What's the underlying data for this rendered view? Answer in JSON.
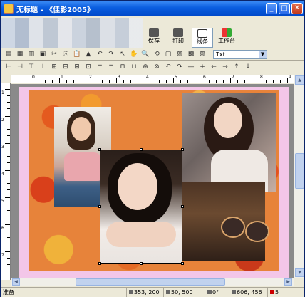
{
  "titlebar": {
    "title": "无标题 - 《佳影2005》",
    "buttons": [
      "_",
      "□",
      "✕"
    ]
  },
  "bigtoolbar": {
    "save_label": "保存",
    "print_label": "打印",
    "frame_label": "线条",
    "workbench_label": "工作台"
  },
  "toolbar1": {
    "tools": [
      "▤",
      "▦",
      "▥",
      "▣",
      "✂",
      "⎘",
      "📋",
      "▲",
      "↶",
      "↷",
      "↖",
      "✋",
      "🔍",
      "⟲",
      "▢",
      "▨",
      "▩",
      "▧"
    ],
    "font_value": "Txt"
  },
  "toolbar2": {
    "tools": [
      "⊢",
      "⊣",
      "⊤",
      "⊥",
      "⊞",
      "⊟",
      "⊠",
      "⊡",
      "⊏",
      "⊐",
      "⊓",
      "⊔",
      "⊕",
      "⊗",
      "↶",
      "↷",
      "—",
      "+",
      "←",
      "→",
      "↑",
      "↓"
    ]
  },
  "rulers": {
    "h_labels": [
      "0",
      "1",
      "2",
      "3",
      "4",
      "5",
      "6",
      "7",
      "8",
      "9"
    ],
    "v_labels": [
      "1",
      "2",
      "3",
      "4",
      "5",
      "6",
      "7"
    ]
  },
  "statusbar": {
    "ready": "准备",
    "cursor": "353, 200",
    "origin": "50, 500",
    "angle": "0°",
    "size": "606, 456",
    "zoom": "5"
  }
}
